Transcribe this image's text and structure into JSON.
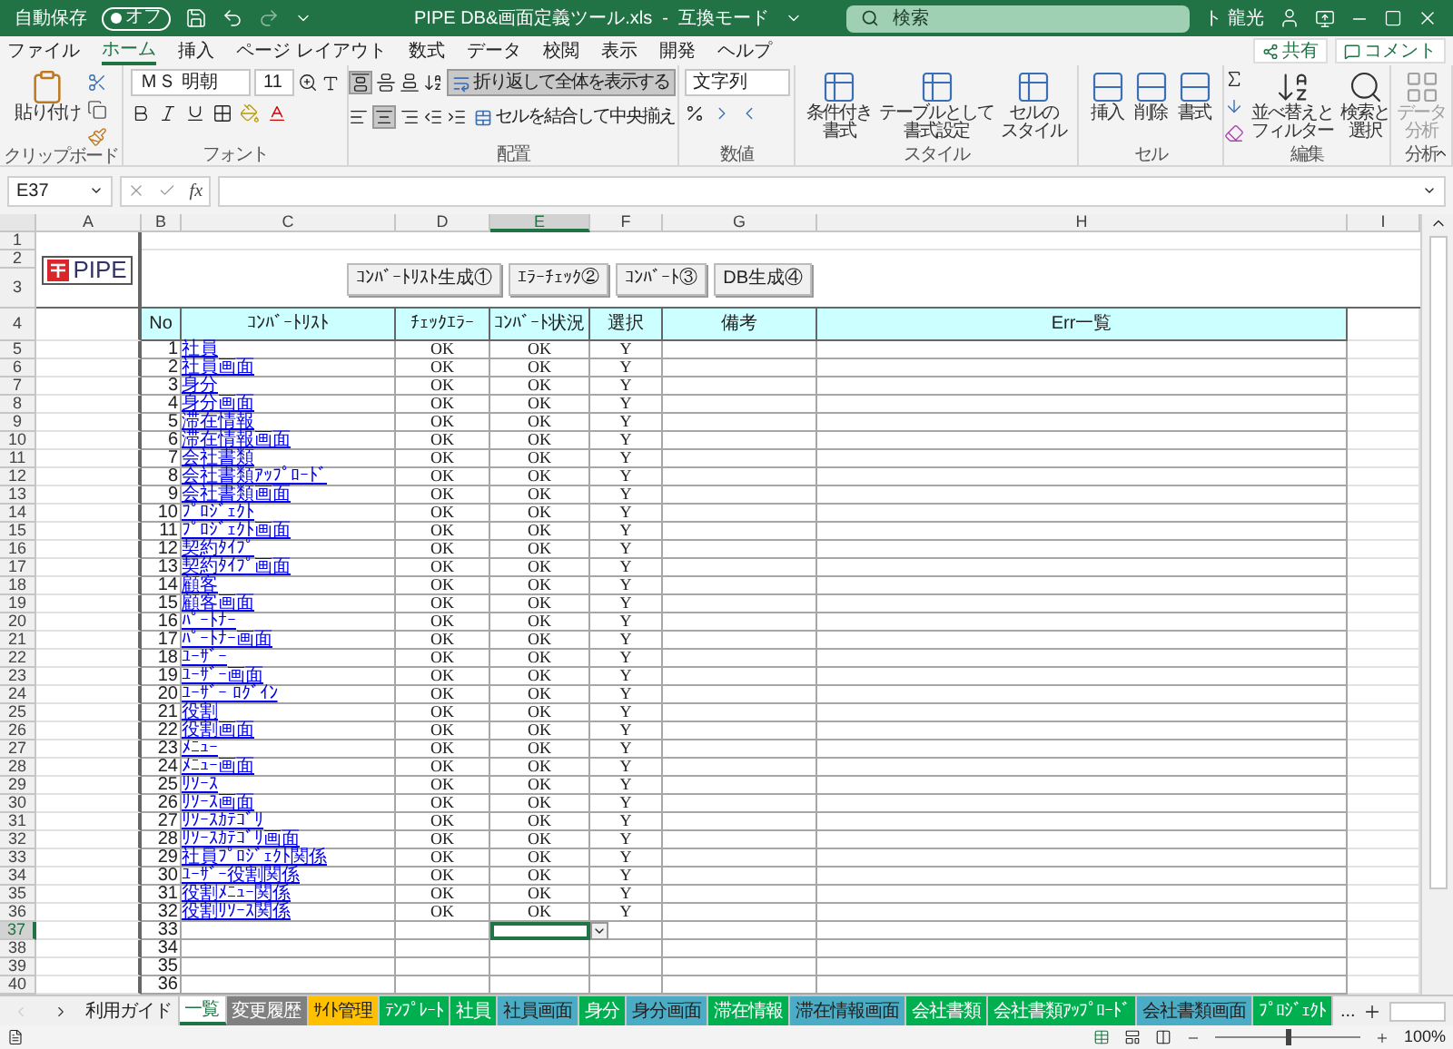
{
  "title_bar": {
    "autosave_label": "自動保存",
    "autosave_toggle": "オフ",
    "autosave_on": false,
    "title": "PIPE DB&画面定義ツール.xls  -  互換モード",
    "search_placeholder": "検索",
    "user": "ト 龍光"
  },
  "menu_tabs": [
    {
      "label": "ファイル",
      "selected": false
    },
    {
      "label": "ホーム",
      "selected": true
    },
    {
      "label": "挿入",
      "selected": false
    },
    {
      "label": "ページ レイアウト",
      "selected": false
    },
    {
      "label": "数式",
      "selected": false
    },
    {
      "label": "データ",
      "selected": false
    },
    {
      "label": "校閲",
      "selected": false
    },
    {
      "label": "表示",
      "selected": false
    },
    {
      "label": "開発",
      "selected": false
    },
    {
      "label": "ヘルプ",
      "selected": false
    }
  ],
  "share_button": "共有",
  "comment_button": "コメント",
  "ribbon": {
    "clipboard": {
      "paste": "貼り付け",
      "label": "クリップボード"
    },
    "font": {
      "font_name": "ＭＳ 明朝",
      "font_size": "11",
      "label": "フォント"
    },
    "alignment": {
      "top_align_selected": true,
      "center_selected": true,
      "wrap_text": "折り返して全体を表示する",
      "wrap_selected": true,
      "merge": "セルを結合して中央揃え",
      "label": "配置"
    },
    "number": {
      "format": "文字列",
      "label": "数値"
    },
    "styles": {
      "buttons": [
        {
          "line1": "条件付き",
          "line2": "書式"
        },
        {
          "line1": "テーブルとして",
          "line2": "書式設定"
        },
        {
          "line1": "セルの",
          "line2": "スタイル"
        }
      ],
      "label": "スタイル"
    },
    "cells": {
      "buttons": [
        "挿入",
        "削除",
        "書式"
      ],
      "label": "セル"
    },
    "editing": {
      "sort": {
        "line1": "並べ替えと",
        "line2": "フィルター"
      },
      "find": {
        "line1": "検索と",
        "line2": "選択"
      },
      "label": "編集"
    },
    "analysis": {
      "line1": "データ",
      "line2": "分析",
      "disabled": true,
      "label": "分析"
    }
  },
  "formula_bar": {
    "name_box": "E37",
    "fx": "fx"
  },
  "columns": [
    {
      "label": "A",
      "selected": false
    },
    {
      "label": "B",
      "selected": false
    },
    {
      "label": "C",
      "selected": false
    },
    {
      "label": "D",
      "selected": false
    },
    {
      "label": "E",
      "selected": true
    },
    {
      "label": "F",
      "selected": false
    },
    {
      "label": "G",
      "selected": false
    },
    {
      "label": "H",
      "selected": false
    },
    {
      "label": "I",
      "selected": false
    }
  ],
  "row_headers": [
    {
      "label": "1",
      "selected": false
    },
    {
      "label": "2",
      "selected": false
    },
    {
      "label": "3",
      "selected": false
    },
    {
      "label": "4",
      "selected": false
    },
    {
      "label": "5",
      "selected": false
    },
    {
      "label": "6",
      "selected": false
    },
    {
      "label": "7",
      "selected": false
    },
    {
      "label": "8",
      "selected": false
    },
    {
      "label": "9",
      "selected": false
    },
    {
      "label": "10",
      "selected": false
    },
    {
      "label": "11",
      "selected": false
    },
    {
      "label": "12",
      "selected": false
    },
    {
      "label": "13",
      "selected": false
    },
    {
      "label": "14",
      "selected": false
    },
    {
      "label": "15",
      "selected": false
    },
    {
      "label": "16",
      "selected": false
    },
    {
      "label": "17",
      "selected": false
    },
    {
      "label": "18",
      "selected": false
    },
    {
      "label": "19",
      "selected": false
    },
    {
      "label": "20",
      "selected": false
    },
    {
      "label": "21",
      "selected": false
    },
    {
      "label": "22",
      "selected": false
    },
    {
      "label": "23",
      "selected": false
    },
    {
      "label": "24",
      "selected": false
    },
    {
      "label": "25",
      "selected": false
    },
    {
      "label": "26",
      "selected": false
    },
    {
      "label": "27",
      "selected": false
    },
    {
      "label": "28",
      "selected": false
    },
    {
      "label": "29",
      "selected": false
    },
    {
      "label": "30",
      "selected": false
    },
    {
      "label": "31",
      "selected": false
    },
    {
      "label": "32",
      "selected": false
    },
    {
      "label": "33",
      "selected": false
    },
    {
      "label": "34",
      "selected": false
    },
    {
      "label": "35",
      "selected": false
    },
    {
      "label": "36",
      "selected": false
    },
    {
      "label": "37",
      "selected": true
    },
    {
      "label": "38",
      "selected": false
    },
    {
      "label": "39",
      "selected": false
    },
    {
      "label": "40",
      "selected": false
    }
  ],
  "logo": {
    "text": "PIPE"
  },
  "sheet_buttons": [
    "ｺﾝﾊﾞｰﾄﾘｽﾄ生成①",
    "ｴﾗｰﾁｪｯｸ②",
    "ｺﾝﾊﾞｰﾄ③",
    "DB生成④"
  ],
  "table_headers": [
    "No",
    "ｺﾝﾊﾞｰﾄﾘｽﾄ",
    "ﾁｪｯｸｴﾗｰ",
    "ｺﾝﾊﾞｰﾄ状況",
    "選択",
    "備考",
    "Err一覧"
  ],
  "rows": [
    {
      "no": "1",
      "name": "社員",
      "check": "OK",
      "status": "OK",
      "select": "Y",
      "selected": false
    },
    {
      "no": "2",
      "name": "社員画面",
      "check": "OK",
      "status": "OK",
      "select": "Y",
      "selected": false
    },
    {
      "no": "3",
      "name": "身分",
      "check": "OK",
      "status": "OK",
      "select": "Y",
      "selected": false
    },
    {
      "no": "4",
      "name": "身分画面",
      "check": "OK",
      "status": "OK",
      "select": "Y",
      "selected": false
    },
    {
      "no": "5",
      "name": "滞在情報",
      "check": "OK",
      "status": "OK",
      "select": "Y",
      "selected": false
    },
    {
      "no": "6",
      "name": "滞在情報画面",
      "check": "OK",
      "status": "OK",
      "select": "Y",
      "selected": false
    },
    {
      "no": "7",
      "name": "会社書類",
      "check": "OK",
      "status": "OK",
      "select": "Y",
      "selected": false
    },
    {
      "no": "8",
      "name": "会社書類ｱｯﾌﾟﾛｰﾄﾞ",
      "check": "OK",
      "status": "OK",
      "select": "Y",
      "selected": false
    },
    {
      "no": "9",
      "name": "会社書類画面",
      "check": "OK",
      "status": "OK",
      "select": "Y",
      "selected": false
    },
    {
      "no": "10",
      "name": "ﾌﾟﾛｼﾞｪｸﾄ",
      "check": "OK",
      "status": "OK",
      "select": "Y",
      "selected": false
    },
    {
      "no": "11",
      "name": "ﾌﾟﾛｼﾞｪｸﾄ画面",
      "check": "OK",
      "status": "OK",
      "select": "Y",
      "selected": false
    },
    {
      "no": "12",
      "name": "契約ﾀｲﾌﾟ",
      "check": "OK",
      "status": "OK",
      "select": "Y",
      "selected": false
    },
    {
      "no": "13",
      "name": "契約ﾀｲﾌﾟ画面",
      "check": "OK",
      "status": "OK",
      "select": "Y",
      "selected": false
    },
    {
      "no": "14",
      "name": "顧客",
      "check": "OK",
      "status": "OK",
      "select": "Y",
      "selected": false
    },
    {
      "no": "15",
      "name": "顧客画面",
      "check": "OK",
      "status": "OK",
      "select": "Y",
      "selected": false
    },
    {
      "no": "16",
      "name": "ﾊﾟｰﾄﾅｰ",
      "check": "OK",
      "status": "OK",
      "select": "Y",
      "selected": false
    },
    {
      "no": "17",
      "name": "ﾊﾟｰﾄﾅｰ画面",
      "check": "OK",
      "status": "OK",
      "select": "Y",
      "selected": false
    },
    {
      "no": "18",
      "name": "ﾕｰｻﾞｰ",
      "check": "OK",
      "status": "OK",
      "select": "Y",
      "selected": false
    },
    {
      "no": "19",
      "name": "ﾕｰｻﾞｰ画面",
      "check": "OK",
      "status": "OK",
      "select": "Y",
      "selected": false
    },
    {
      "no": "20",
      "name": "ﾕｰｻﾞｰ ﾛｸﾞｲﾝ",
      "check": "OK",
      "status": "OK",
      "select": "Y",
      "selected": false
    },
    {
      "no": "21",
      "name": "役割",
      "check": "OK",
      "status": "OK",
      "select": "Y",
      "selected": false
    },
    {
      "no": "22",
      "name": "役割画面",
      "check": "OK",
      "status": "OK",
      "select": "Y",
      "selected": false
    },
    {
      "no": "23",
      "name": "ﾒﾆｭｰ",
      "check": "OK",
      "status": "OK",
      "select": "Y",
      "selected": false
    },
    {
      "no": "24",
      "name": "ﾒﾆｭｰ画面",
      "check": "OK",
      "status": "OK",
      "select": "Y",
      "selected": false
    },
    {
      "no": "25",
      "name": "ﾘｿｰｽ",
      "check": "OK",
      "status": "OK",
      "select": "Y",
      "selected": false
    },
    {
      "no": "26",
      "name": "ﾘｿｰｽ画面",
      "check": "OK",
      "status": "OK",
      "select": "Y",
      "selected": false
    },
    {
      "no": "27",
      "name": "ﾘｿｰｽｶﾃｺﾞﾘ",
      "check": "OK",
      "status": "OK",
      "select": "Y",
      "selected": false
    },
    {
      "no": "28",
      "name": "ﾘｿｰｽｶﾃｺﾞﾘ画面",
      "check": "OK",
      "status": "OK",
      "select": "Y",
      "selected": false
    },
    {
      "no": "29",
      "name": "社員ﾌﾟﾛｼﾞｪｸﾄ関係",
      "check": "OK",
      "status": "OK",
      "select": "Y",
      "selected": false
    },
    {
      "no": "30",
      "name": "ﾕｰｻﾞｰ役割関係",
      "check": "OK",
      "status": "OK",
      "select": "Y",
      "selected": false
    },
    {
      "no": "31",
      "name": "役割ﾒﾆｭｰ関係",
      "check": "OK",
      "status": "OK",
      "select": "Y",
      "selected": false
    },
    {
      "no": "32",
      "name": "役割ﾘｿｰｽ関係",
      "check": "OK",
      "status": "OK",
      "select": "Y",
      "selected": false
    },
    {
      "no": "33",
      "selected": true
    },
    {
      "no": "34",
      "selected": false
    },
    {
      "no": "35",
      "selected": false
    },
    {
      "no": "36",
      "selected": false
    }
  ],
  "sheet_tabs": [
    {
      "label": "利用ガイド",
      "selected": false
    },
    {
      "label": "一覧",
      "selected": true
    },
    {
      "label": "変更履歴",
      "selected": false,
      "color": "#808080"
    },
    {
      "label": "ｻｲﾄ管理",
      "selected": false,
      "color": "#ffc000"
    },
    {
      "label": "ﾃﾝﾌﾟﾚｰﾄ",
      "selected": false,
      "color": "#00b050"
    },
    {
      "label": "社員",
      "selected": false,
      "color": "#00b050"
    },
    {
      "label": "社員画面",
      "selected": false,
      "color": "#4bacc6"
    },
    {
      "label": "身分",
      "selected": false,
      "color": "#00b050"
    },
    {
      "label": "身分画面",
      "selected": false,
      "color": "#4bacc6"
    },
    {
      "label": "滞在情報",
      "selected": false,
      "color": "#00b050"
    },
    {
      "label": "滞在情報画面",
      "selected": false,
      "color": "#4bacc6"
    },
    {
      "label": "会社書類",
      "selected": false,
      "color": "#00b050"
    },
    {
      "label": "会社書類ｱｯﾌﾟﾛｰﾄﾞ",
      "selected": false,
      "color": "#00b050"
    },
    {
      "label": "会社書類画面",
      "selected": false,
      "color": "#4bacc6"
    },
    {
      "label": "ﾌﾟﾛｼﾞｪｸﾄ",
      "selected": false,
      "color": "#00b050"
    }
  ],
  "more_tabs": "...",
  "status_bar": {
    "zoom": "100%",
    "zoom_level": {
      "level": 0.5
    }
  }
}
